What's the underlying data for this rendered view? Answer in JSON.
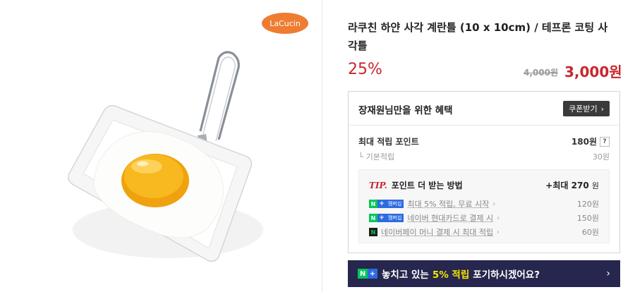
{
  "brand": {
    "logo_text": "LaCucin",
    "logo_color": "#ee7d32"
  },
  "product": {
    "title": "라쿠친 하얀 사각 계란틀 (10 x 10cm) / 테프론 코팅 사각틀",
    "discount_rate": "25%",
    "original_price": "4,000원",
    "sale_price": "3,000원"
  },
  "benefits": {
    "title": "장재원님만을 위한 혜택",
    "coupon_button": "쿠폰받기",
    "max_points_label": "최대 적립 포인트",
    "max_points_value": "180원",
    "help_label": "?",
    "base_points_label": "기본적립",
    "base_points_value": "30원",
    "tip": {
      "tag": "TIP.",
      "title": "포인트 더 받는 방법",
      "max_prefix": "+최대",
      "max_value": "270",
      "max_unit": "원",
      "rows": [
        {
          "badge": "N+ 멤버십",
          "label": "최대 5% 적립, 무료 시작",
          "value": "120원",
          "icon": "nplus-membership-icon"
        },
        {
          "badge": "N+ 멤버십",
          "label": "네이버 현대카드로 결제 시",
          "value": "150원",
          "icon": "nplus-membership-icon"
        },
        {
          "badge": "N",
          "label": "네이버페이 머니 결제 시 최대 적립",
          "value": "60원",
          "icon": "naverpay-icon"
        }
      ]
    }
  },
  "banner": {
    "text_before": "놓치고 있는",
    "highlight": "5% 적립",
    "text_after": "포기하시겠어요?",
    "bg_color": "#26264e",
    "highlight_color": "#f7e600"
  },
  "colors": {
    "accent_red": "#c8262d",
    "naver_green": "#03c75a",
    "membership_blue": "#2d6be0"
  }
}
